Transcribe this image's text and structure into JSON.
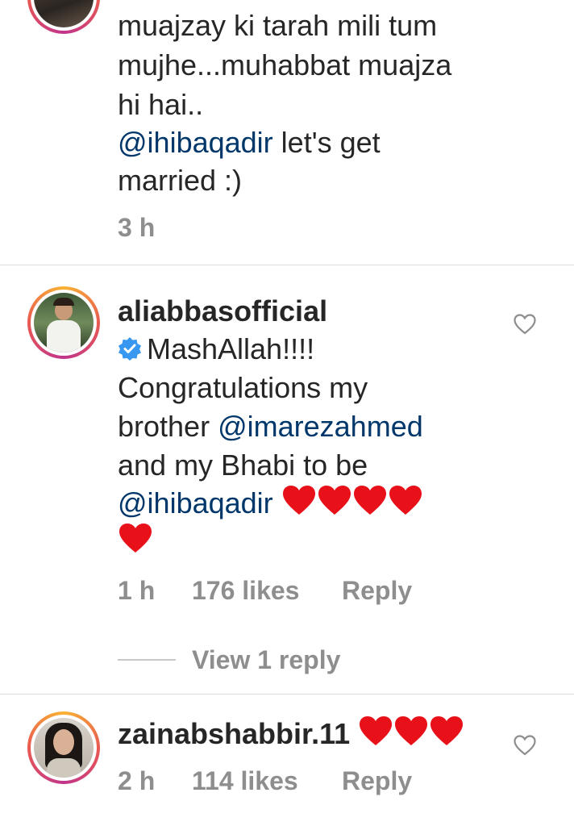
{
  "comments": [
    {
      "lines": [
        "muajzay ki tarah mili tum",
        "mujhe...muhabbat muajza",
        "hi hai.."
      ],
      "mention": "@ihibaqadir",
      "mention_tail": "let's get",
      "last_line": "married :)",
      "time": "3 h"
    },
    {
      "username": "aliabbasofficial",
      "text_line1": "MashAllah!!!!",
      "text_line2": "Congratulations my",
      "text_line3_pre": "brother",
      "mention1": "@imarezahmed",
      "text_line4": "and my Bhabi to be",
      "mention2": "@ihibaqadir",
      "time": "1 h",
      "likes": "176 likes",
      "reply_label": "Reply",
      "view_replies": "View 1 reply"
    },
    {
      "username": "zainabshabbir.11",
      "time": "2 h",
      "likes": "114 likes",
      "reply_label": "Reply"
    }
  ],
  "colors": {
    "text": "#262626",
    "mention": "#00376b",
    "meta": "#8e8e8e",
    "heart": "#e8111a",
    "verified": "#3897f0"
  },
  "icons": [
    "heart-emoji",
    "verified-badge-icon",
    "like-heart-icon"
  ]
}
